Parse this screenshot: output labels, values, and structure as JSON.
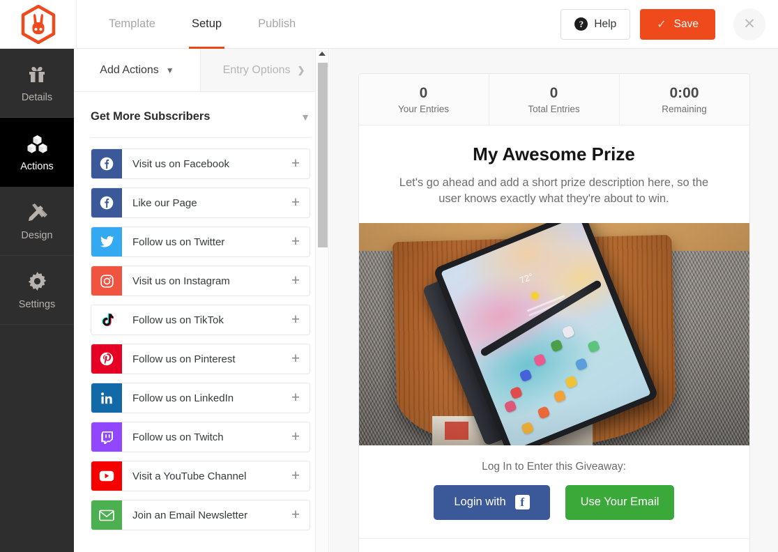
{
  "app": {
    "logo_icon": "rabbit-hexagon-logo",
    "brand_color": "#ef4a1c"
  },
  "topbar": {
    "tabs": [
      {
        "label": "Template",
        "active": false
      },
      {
        "label": "Setup",
        "active": true
      },
      {
        "label": "Publish",
        "active": false
      }
    ],
    "help_label": "Help",
    "help_icon": "question-mark-circle-icon",
    "save_label": "Save",
    "save_icon": "checkmark-icon",
    "close_icon": "close-x-icon"
  },
  "sidebar": {
    "items": [
      {
        "label": "Details",
        "icon": "gift-icon",
        "active": false
      },
      {
        "label": "Actions",
        "icon": "blocks-cubes-icon",
        "active": true
      },
      {
        "label": "Design",
        "icon": "pencil-ruler-icon",
        "active": false
      },
      {
        "label": "Settings",
        "icon": "gear-icon",
        "active": false
      }
    ]
  },
  "panel": {
    "tabs": [
      {
        "label": "Add Actions",
        "icon": "chevron-down-icon",
        "active": true
      },
      {
        "label": "Entry Options",
        "icon": "chevron-right-icon",
        "active": false
      }
    ],
    "group_title": "Get More Subscribers",
    "group_chevron": "chevron-down-icon",
    "actions": [
      {
        "label": "Visit us on Facebook",
        "icon": "facebook-icon",
        "color": "#3b5998",
        "plus": "+"
      },
      {
        "label": "Like our Page",
        "icon": "facebook-icon",
        "color": "#3b5998",
        "plus": "+"
      },
      {
        "label": "Follow us on Twitter",
        "icon": "twitter-icon",
        "color": "#33a9f2",
        "plus": "+"
      },
      {
        "label": "Visit us on Instagram",
        "icon": "instagram-icon",
        "color": "#f05340",
        "plus": "+"
      },
      {
        "label": "Follow us on TikTok",
        "icon": "tiktok-icon",
        "color": "#ffffff",
        "plus": "+"
      },
      {
        "label": "Follow us on Pinterest",
        "icon": "pinterest-icon",
        "color": "#e60023",
        "plus": "+"
      },
      {
        "label": "Follow us on LinkedIn",
        "icon": "linkedin-icon",
        "color": "#1269a8",
        "plus": "+"
      },
      {
        "label": "Follow us on Twitch",
        "icon": "twitch-icon",
        "color": "#9146ff",
        "plus": "+"
      },
      {
        "label": "Visit a YouTube Channel",
        "icon": "youtube-icon",
        "color": "#f60000",
        "plus": "+"
      },
      {
        "label": "Join an Email Newsletter",
        "icon": "envelope-icon",
        "color": "#4caf50",
        "plus": "+"
      }
    ]
  },
  "scrollbar": {
    "up_arrow_icon": "scroll-up-arrow-icon"
  },
  "preview": {
    "stats": [
      {
        "value": "0",
        "label": "Your Entries"
      },
      {
        "value": "0",
        "label": "Total Entries"
      },
      {
        "value": "0:00",
        "label": "Remaining"
      }
    ],
    "prize_title": "My Awesome Prize",
    "prize_description": "Let's go ahead and add a short prize description here, so the user knows exactly what they're about to win.",
    "image_alt": "Tablet with stylus on a wooden side table",
    "login_prompt": "Log In to Enter this Giveaway:",
    "facebook_login_label": "Login with",
    "facebook_login_icon": "facebook-square-icon",
    "email_login_label": "Use Your Email",
    "facebook_color": "#3b5998",
    "email_color": "#3aa93a"
  }
}
